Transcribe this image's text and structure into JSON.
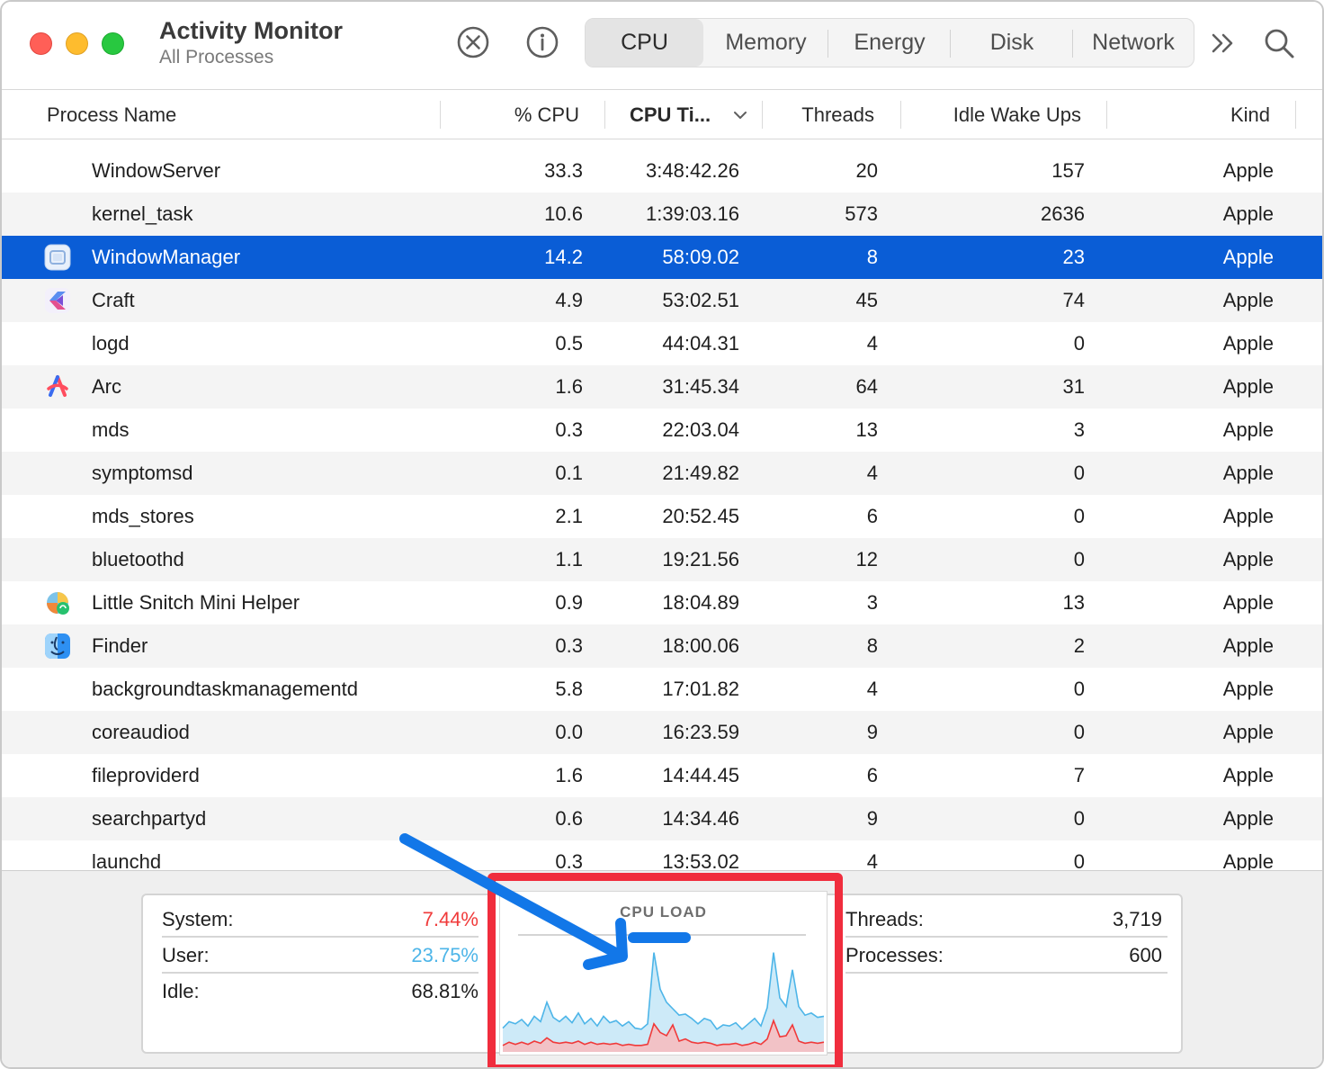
{
  "window": {
    "title": "Activity Monitor",
    "subtitle": "All Processes"
  },
  "toolbar": {
    "stop_icon": "stop-process-icon",
    "info_icon": "info-icon",
    "tabs": [
      {
        "label": "CPU",
        "active": true
      },
      {
        "label": "Memory",
        "active": false
      },
      {
        "label": "Energy",
        "active": false
      },
      {
        "label": "Disk",
        "active": false
      },
      {
        "label": "Network",
        "active": false
      }
    ],
    "overflow_icon": "chevron-double-right-icon",
    "search_icon": "search-icon"
  },
  "table": {
    "columns": {
      "name": "Process Name",
      "cpu": "% CPU",
      "cpu_time": "CPU Ti...",
      "threads": "Threads",
      "idle_wake_ups": "Idle Wake Ups",
      "kind": "Kind"
    },
    "sorted_column": "cpu_time",
    "rows": [
      {
        "name": "WindowServer",
        "cpu": "33.3",
        "time": "3:48:42.26",
        "threads": "20",
        "idle": "157",
        "kind": "Apple",
        "icon": ""
      },
      {
        "name": "kernel_task",
        "cpu": "10.6",
        "time": "1:39:03.16",
        "threads": "573",
        "idle": "2636",
        "kind": "Apple",
        "icon": ""
      },
      {
        "name": "WindowManager",
        "cpu": "14.2",
        "time": "58:09.02",
        "threads": "8",
        "idle": "23",
        "kind": "Apple",
        "icon": "window-manager-icon",
        "selected": true
      },
      {
        "name": "Craft",
        "cpu": "4.9",
        "time": "53:02.51",
        "threads": "45",
        "idle": "74",
        "kind": "Apple",
        "icon": "craft-app-icon"
      },
      {
        "name": "logd",
        "cpu": "0.5",
        "time": "44:04.31",
        "threads": "4",
        "idle": "0",
        "kind": "Apple",
        "icon": ""
      },
      {
        "name": "Arc",
        "cpu": "1.6",
        "time": "31:45.34",
        "threads": "64",
        "idle": "31",
        "kind": "Apple",
        "icon": "arc-browser-icon"
      },
      {
        "name": "mds",
        "cpu": "0.3",
        "time": "22:03.04",
        "threads": "13",
        "idle": "3",
        "kind": "Apple",
        "icon": ""
      },
      {
        "name": "symptomsd",
        "cpu": "0.1",
        "time": "21:49.82",
        "threads": "4",
        "idle": "0",
        "kind": "Apple",
        "icon": ""
      },
      {
        "name": "mds_stores",
        "cpu": "2.1",
        "time": "20:52.45",
        "threads": "6",
        "idle": "0",
        "kind": "Apple",
        "icon": ""
      },
      {
        "name": "bluetoothd",
        "cpu": "1.1",
        "time": "19:21.56",
        "threads": "12",
        "idle": "0",
        "kind": "Apple",
        "icon": ""
      },
      {
        "name": "Little Snitch Mini Helper",
        "cpu": "0.9",
        "time": "18:04.89",
        "threads": "3",
        "idle": "13",
        "kind": "Apple",
        "icon": "little-snitch-icon"
      },
      {
        "name": "Finder",
        "cpu": "0.3",
        "time": "18:00.06",
        "threads": "8",
        "idle": "2",
        "kind": "Apple",
        "icon": "finder-icon"
      },
      {
        "name": "backgroundtaskmanagementd",
        "cpu": "5.8",
        "time": "17:01.82",
        "threads": "4",
        "idle": "0",
        "kind": "Apple",
        "icon": ""
      },
      {
        "name": "coreaudiod",
        "cpu": "0.0",
        "time": "16:23.59",
        "threads": "9",
        "idle": "0",
        "kind": "Apple",
        "icon": ""
      },
      {
        "name": "fileproviderd",
        "cpu": "1.6",
        "time": "14:44.45",
        "threads": "6",
        "idle": "7",
        "kind": "Apple",
        "icon": ""
      },
      {
        "name": "searchpartyd",
        "cpu": "0.6",
        "time": "14:34.46",
        "threads": "9",
        "idle": "0",
        "kind": "Apple",
        "icon": ""
      },
      {
        "name": "launchd",
        "cpu": "0.3",
        "time": "13:53.02",
        "threads": "4",
        "idle": "0",
        "kind": "Apple",
        "icon": ""
      }
    ]
  },
  "summary": {
    "system_label": "System:",
    "system_value": "7.44%",
    "user_label": "User:",
    "user_value": "23.75%",
    "idle_label": "Idle:",
    "idle_value": "68.81%",
    "threads_label": "Threads:",
    "threads_value": "3,719",
    "processes_label": "Processes:",
    "processes_value": "600",
    "graph_title": "CPU LOAD",
    "colors": {
      "system": "#f03a3a",
      "user": "#4db5e8",
      "highlight": "#f02d3d",
      "arrow": "#1277e8",
      "selection": "#0a5dd6"
    }
  },
  "chart_data": {
    "type": "area",
    "title": "CPU LOAD",
    "series": [
      {
        "values": [
          22,
          28,
          26,
          30,
          24,
          33,
          28,
          46,
          32,
          28,
          33,
          27,
          36,
          26,
          31,
          24,
          33,
          27,
          29,
          24,
          28,
          22,
          21,
          26,
          92,
          58,
          46,
          40,
          34,
          35,
          31,
          26,
          31,
          29,
          21,
          25,
          24,
          27,
          21,
          26,
          31,
          24,
          41,
          92,
          50,
          42,
          76,
          42,
          34,
          36,
          32,
          33
        ]
      },
      {
        "values": [
          6,
          9,
          7,
          9,
          7,
          10,
          8,
          13,
          9,
          8,
          9,
          8,
          10,
          7,
          9,
          7,
          8,
          7,
          8,
          6,
          7,
          6,
          6,
          7,
          26,
          18,
          15,
          25,
          10,
          12,
          9,
          8,
          9,
          8,
          6,
          7,
          7,
          8,
          6,
          7,
          9,
          7,
          12,
          29,
          14,
          15,
          25,
          10,
          8,
          9,
          8,
          9
        ]
      }
    ]
  }
}
